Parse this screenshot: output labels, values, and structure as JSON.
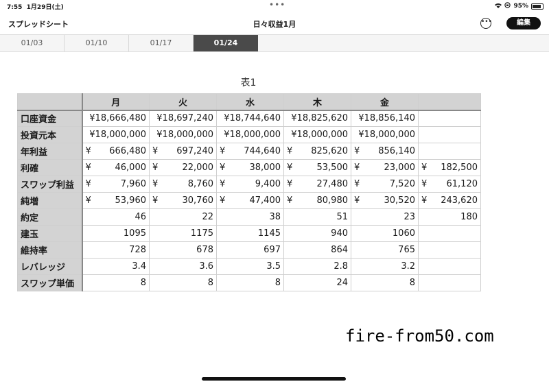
{
  "status": {
    "time": "7:55",
    "date": "1月29日(土)",
    "battery": "95%"
  },
  "app": {
    "name": "スプレッドシート",
    "title": "日々収益1月",
    "edit_label": "編集"
  },
  "tabs": [
    {
      "label": "01/03",
      "active": false
    },
    {
      "label": "01/10",
      "active": false
    },
    {
      "label": "01/17",
      "active": false
    },
    {
      "label": "01/24",
      "active": true
    }
  ],
  "table": {
    "title": "表1",
    "headers": [
      "",
      "月",
      "火",
      "水",
      "木",
      "金",
      ""
    ],
    "rows": [
      {
        "label": "口座資金",
        "cells": [
          {
            "text": "¥18,666,480"
          },
          {
            "text": "¥18,697,240"
          },
          {
            "text": "¥18,744,640"
          },
          {
            "text": "¥18,825,620"
          },
          {
            "text": "¥18,856,140"
          },
          {
            "text": ""
          }
        ]
      },
      {
        "label": "投資元本",
        "cells": [
          {
            "text": "¥18,000,000"
          },
          {
            "text": "¥18,000,000"
          },
          {
            "text": "¥18,000,000"
          },
          {
            "text": "¥18,000,000"
          },
          {
            "text": "¥18,000,000"
          },
          {
            "text": ""
          }
        ]
      },
      {
        "label": "年利益",
        "cells": [
          {
            "cur": "¥",
            "text": "666,480"
          },
          {
            "cur": "¥",
            "text": "697,240"
          },
          {
            "cur": "¥",
            "text": "744,640"
          },
          {
            "cur": "¥",
            "text": "825,620"
          },
          {
            "cur": "¥",
            "text": "856,140"
          },
          {
            "text": ""
          }
        ]
      },
      {
        "label": "利確",
        "cells": [
          {
            "cur": "¥",
            "text": "46,000"
          },
          {
            "cur": "¥",
            "text": "22,000"
          },
          {
            "cur": "¥",
            "text": "38,000"
          },
          {
            "cur": "¥",
            "text": "53,500"
          },
          {
            "cur": "¥",
            "text": "23,000"
          },
          {
            "cur": "¥",
            "text": "182,500"
          }
        ]
      },
      {
        "label": "スワップ利益",
        "cells": [
          {
            "cur": "¥",
            "text": "7,960"
          },
          {
            "cur": "¥",
            "text": "8,760"
          },
          {
            "cur": "¥",
            "text": "9,400"
          },
          {
            "cur": "¥",
            "text": "27,480"
          },
          {
            "cur": "¥",
            "text": "7,520"
          },
          {
            "cur": "¥",
            "text": "61,120"
          }
        ]
      },
      {
        "label": "純増",
        "cells": [
          {
            "cur": "¥",
            "text": "53,960"
          },
          {
            "cur": "¥",
            "text": "30,760"
          },
          {
            "cur": "¥",
            "text": "47,400"
          },
          {
            "cur": "¥",
            "text": "80,980"
          },
          {
            "cur": "¥",
            "text": "30,520"
          },
          {
            "cur": "¥",
            "text": "243,620"
          }
        ]
      },
      {
        "label": "約定",
        "cells": [
          {
            "text": "46"
          },
          {
            "text": "22"
          },
          {
            "text": "38"
          },
          {
            "text": "51"
          },
          {
            "text": "23"
          },
          {
            "text": "180"
          }
        ]
      },
      {
        "label": "建玉",
        "cells": [
          {
            "text": "1095"
          },
          {
            "text": "1175"
          },
          {
            "text": "1145"
          },
          {
            "text": "940"
          },
          {
            "text": "1060"
          },
          {
            "text": ""
          }
        ]
      },
      {
        "label": "維持率",
        "cells": [
          {
            "text": "728"
          },
          {
            "text": "678"
          },
          {
            "text": "697"
          },
          {
            "text": "864"
          },
          {
            "text": "765"
          },
          {
            "text": ""
          }
        ]
      },
      {
        "label": "レバレッジ",
        "cells": [
          {
            "text": "3.4"
          },
          {
            "text": "3.6"
          },
          {
            "text": "3.5"
          },
          {
            "text": "2.8"
          },
          {
            "text": "3.2"
          },
          {
            "text": ""
          }
        ]
      },
      {
        "label": "スワップ単価",
        "cells": [
          {
            "text": "8"
          },
          {
            "text": "8"
          },
          {
            "text": "8"
          },
          {
            "text": "24"
          },
          {
            "text": "8"
          },
          {
            "text": ""
          }
        ]
      }
    ]
  },
  "watermark": "fire-from50.com"
}
